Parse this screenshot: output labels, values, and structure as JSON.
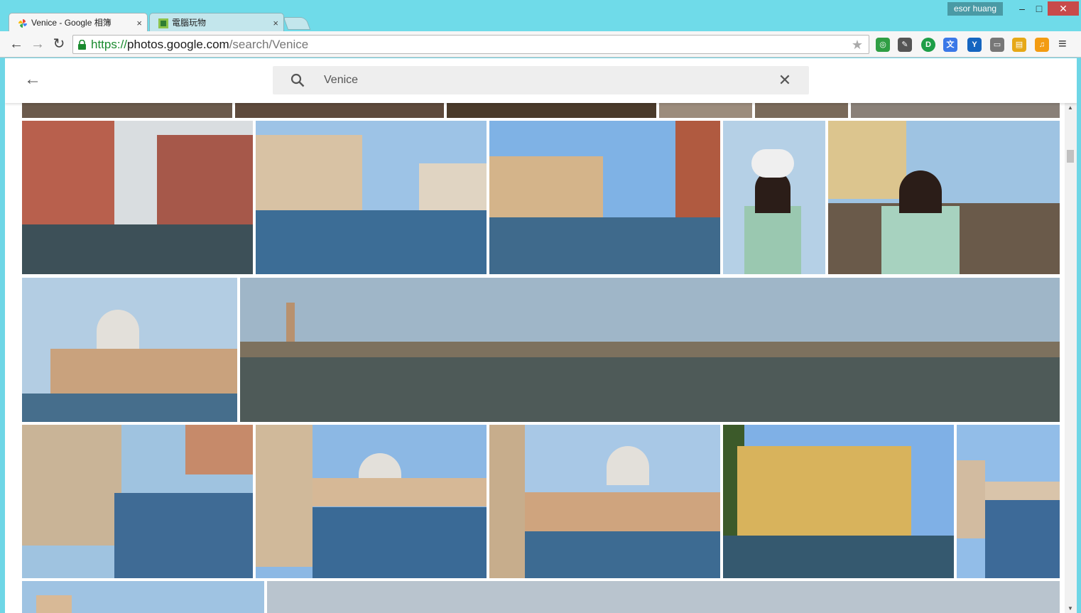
{
  "window": {
    "user_name": "esor huang",
    "min_glyph": "–",
    "max_glyph": "□",
    "close_glyph": "✕"
  },
  "tabs": [
    {
      "title": "Venice - Google 相簿",
      "close_glyph": "×",
      "active": true
    },
    {
      "title": "電腦玩物",
      "close_glyph": "×",
      "active": false
    }
  ],
  "toolbar": {
    "back_glyph": "←",
    "forward_glyph": "→",
    "reload_glyph": "↻",
    "url_scheme": "https://",
    "url_host": "photos.google.com",
    "url_path": "/search/Venice",
    "star_glyph": "★",
    "menu_glyph": "≡",
    "extensions": [
      {
        "name": "sync-extension-icon",
        "color": "#2f9e44",
        "glyph": "◎"
      },
      {
        "name": "evernote-extension-icon",
        "color": "#555555",
        "glyph": "✎"
      },
      {
        "name": "idea-extension-icon",
        "color": "#1e9e48",
        "glyph": "D"
      },
      {
        "name": "translate-extension-icon",
        "color": "#3b78e7",
        "glyph": "文"
      },
      {
        "name": "y-extension-icon",
        "color": "#1565c0",
        "glyph": "Y"
      },
      {
        "name": "cast-extension-icon",
        "color": "#777777",
        "glyph": "▭"
      },
      {
        "name": "clipboard-extension-icon",
        "color": "#e6a817",
        "glyph": "▤"
      },
      {
        "name": "audio-extension-icon",
        "color": "#f39c12",
        "glyph": "♫"
      }
    ]
  },
  "photos_app": {
    "back_glyph": "←",
    "search_query": "Venice",
    "clear_glyph": "✕"
  },
  "colors": {
    "accent": "#6fdbe9",
    "close_button": "#c84a4a",
    "search_bg": "#eeeeee"
  }
}
